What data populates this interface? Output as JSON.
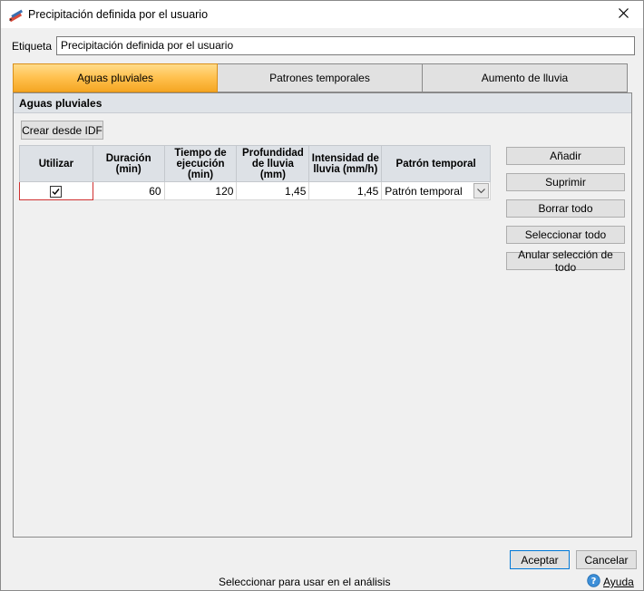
{
  "window": {
    "title": "Precipitación definida por el usuario",
    "app_icon": "pencil-ruler-icon",
    "close_icon": "close-icon"
  },
  "label": {
    "caption": "Etiqueta",
    "value": "Precipitación definida por el usuario"
  },
  "tabs": [
    {
      "label": "Aguas pluviales",
      "active": true
    },
    {
      "label": "Patrones temporales",
      "active": false
    },
    {
      "label": "Aumento de lluvia",
      "active": false
    }
  ],
  "panel": {
    "section_title": "Aguas pluviales",
    "create_idf_label": "Crear desde IDF"
  },
  "table": {
    "headers": {
      "use": "Utilizar",
      "duration_1": "Duración",
      "duration_2": "(min)",
      "runtime_1": "Tiempo de",
      "runtime_2": "ejecución",
      "runtime_3": "(min)",
      "depth_1": "Profundidad",
      "depth_2": "de lluvia (mm)",
      "intensity_1": "Intensidad de",
      "intensity_2": "lluvia (mm/h)",
      "pattern": "Patrón temporal"
    },
    "rows": [
      {
        "checked": true,
        "duration": "60",
        "runtime": "120",
        "depth": "1,45",
        "intensity": "1,45",
        "pattern": "Patrón temporal"
      }
    ]
  },
  "side_buttons": {
    "add": "Añadir",
    "delete": "Suprimir",
    "clear_all": "Borrar todo",
    "select_all": "Seleccionar todo",
    "deselect_all": "Anular selección de todo"
  },
  "footer": {
    "ok": "Aceptar",
    "cancel": "Cancelar",
    "status": "Seleccionar para usar en el análisis",
    "help": "Ayuda",
    "help_icon": "help-icon"
  },
  "colors": {
    "active_tab": "#ffc04d",
    "header_bg": "#dde1e6",
    "invalid_border": "#d03030"
  }
}
